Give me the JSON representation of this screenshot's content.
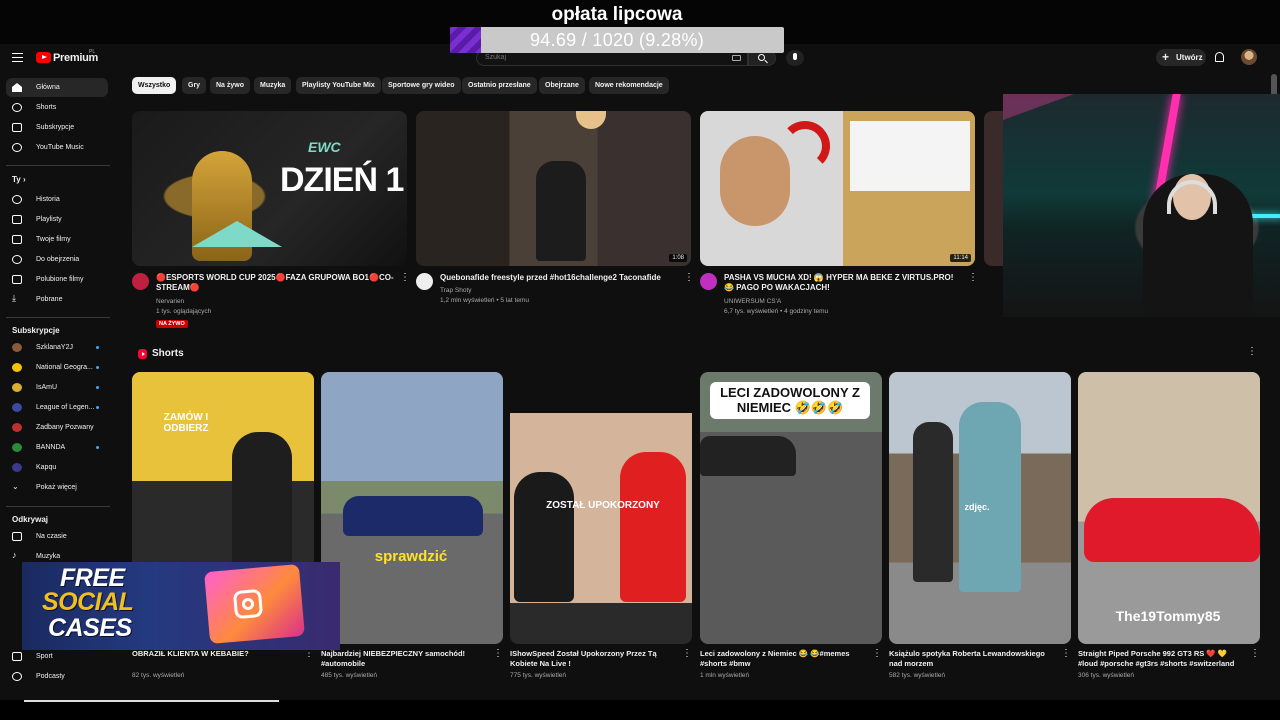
{
  "stream": {
    "goal_title": "opłata lipcowa",
    "goal_text": "94.69 / 1020 (9.28%)",
    "goal_fraction": 0.0928
  },
  "header": {
    "brand": "Premium",
    "brand_suffix": "PL",
    "search_placeholder": "Szukaj",
    "create_label": "Utwórz"
  },
  "sidebar": {
    "main": [
      {
        "label": "Główna",
        "icon": "home-icon",
        "active": true
      },
      {
        "label": "Shorts",
        "icon": "shorts-icon"
      },
      {
        "label": "Subskrypcje",
        "icon": "subscriptions-icon"
      },
      {
        "label": "YouTube Music",
        "icon": "music-icon"
      }
    ],
    "you_heading": "Ty",
    "you": [
      {
        "label": "Historia",
        "icon": "history-icon"
      },
      {
        "label": "Playlisty",
        "icon": "playlist-icon"
      },
      {
        "label": "Twoje filmy",
        "icon": "your-videos-icon"
      },
      {
        "label": "Do obejrzenia",
        "icon": "watch-later-icon"
      },
      {
        "label": "Polubione filmy",
        "icon": "liked-icon"
      },
      {
        "label": "Pobrane",
        "icon": "download-icon"
      }
    ],
    "subs_heading": "Subskrypcje",
    "subs": [
      {
        "label": "SzklanaY2J",
        "color": "#8a5a3a"
      },
      {
        "label": "National Geogra...",
        "color": "#f5c400"
      },
      {
        "label": "IsAmU",
        "color": "#d8b030"
      },
      {
        "label": "League of Legen...",
        "color": "#3a4aa0"
      },
      {
        "label": "Zadbany Pozwany",
        "color": "#c03030"
      },
      {
        "label": "BANNDA",
        "color": "#2a8a3a"
      },
      {
        "label": "Kapqu",
        "color": "#3a3a8a"
      }
    ],
    "show_more": "Pokaż więcej",
    "explore_heading": "Odkrywaj",
    "explore": [
      {
        "label": "Na czasie",
        "icon": "trending-icon"
      },
      {
        "label": "Muzyka",
        "icon": "music-note-icon"
      },
      {
        "label": "Sport",
        "icon": "trophy-icon"
      },
      {
        "label": "Podcasty",
        "icon": "podcast-icon"
      }
    ]
  },
  "chips": [
    "Wszystko",
    "Gry",
    "Na żywo",
    "Muzyka",
    "Playlisty YouTube Mix",
    "Sportowe gry wideo",
    "Ostatnio przesłane",
    "Obejrzane",
    "Nowe rekomendacje"
  ],
  "videos": [
    {
      "title": "🔴ESPORTS WORLD CUP 2025🔴FAZA GRUPOWA BO1🔴CO-STREAM🔴",
      "channel": "Nervarien",
      "meta": "1 tys. oglądających",
      "badge": "NA ŻYWO",
      "thumb_text": "DZIEŃ 1",
      "thumb_small": "EWC",
      "avatar_color": "#c02040"
    },
    {
      "title": "Quebonafide freestyle przed #hot16challenge2 Taconafide",
      "channel": "Trap Shoty",
      "meta": "1,2 mln wyświetleń • 5 lat temu",
      "duration": "1:08",
      "avatar_color": "#eeeeee"
    },
    {
      "title": "PASHA VS MUCHA XD! 😱 HYPER MA BEKE Z VIRTUS.PRO! 😂 PAGO PO WAKACJACH!",
      "channel": "UNIWERSUM CS'A",
      "meta": "6,7 tys. wyświetleń • 4 godziny temu",
      "duration": "11:14",
      "avatar_color": "#c030c0"
    }
  ],
  "shorts": {
    "heading": "Shorts",
    "items": [
      {
        "title": "OBRAZIŁ KLIENTA W KEBABIE?",
        "views": "82 tys. wyświetleń",
        "caption": "ZAMÓW I ODBIERZ"
      },
      {
        "title": "Najbardziej NIEBEZPIECZNY samochód! #automobile",
        "views": "485 tys. wyświetleń",
        "caption": "sprawdzić"
      },
      {
        "title": "IShowSpeed Został Upokorzony Przez Tą Kobiete Na Live !",
        "views": "775 tys. wyświetleń",
        "caption": "ZOSTAŁ UPOKORZONY"
      },
      {
        "title": "Leci zadowolony z Niemiec 😂 😂#memes #shorts #bmw",
        "views": "1 mln wyświetleń",
        "caption": "LECI ZADOWOLONY Z NIEMIEC 🤣🤣🤣"
      },
      {
        "title": "Książulo spotyka Roberta Lewandowskiego nad morzem",
        "views": "582 tys. wyświetleń",
        "caption": "zdjęc."
      },
      {
        "title": "Straight Piped Porsche 992 GT3 RS ❤️ 💛 #loud #porsche #gt3rs #shorts #switzerland",
        "views": "306 tys. wyświetleń",
        "caption": "The19Tommy85"
      }
    ]
  },
  "promo": {
    "line1": "FREE",
    "line2": "SOCIAL",
    "line3": "CASES"
  }
}
